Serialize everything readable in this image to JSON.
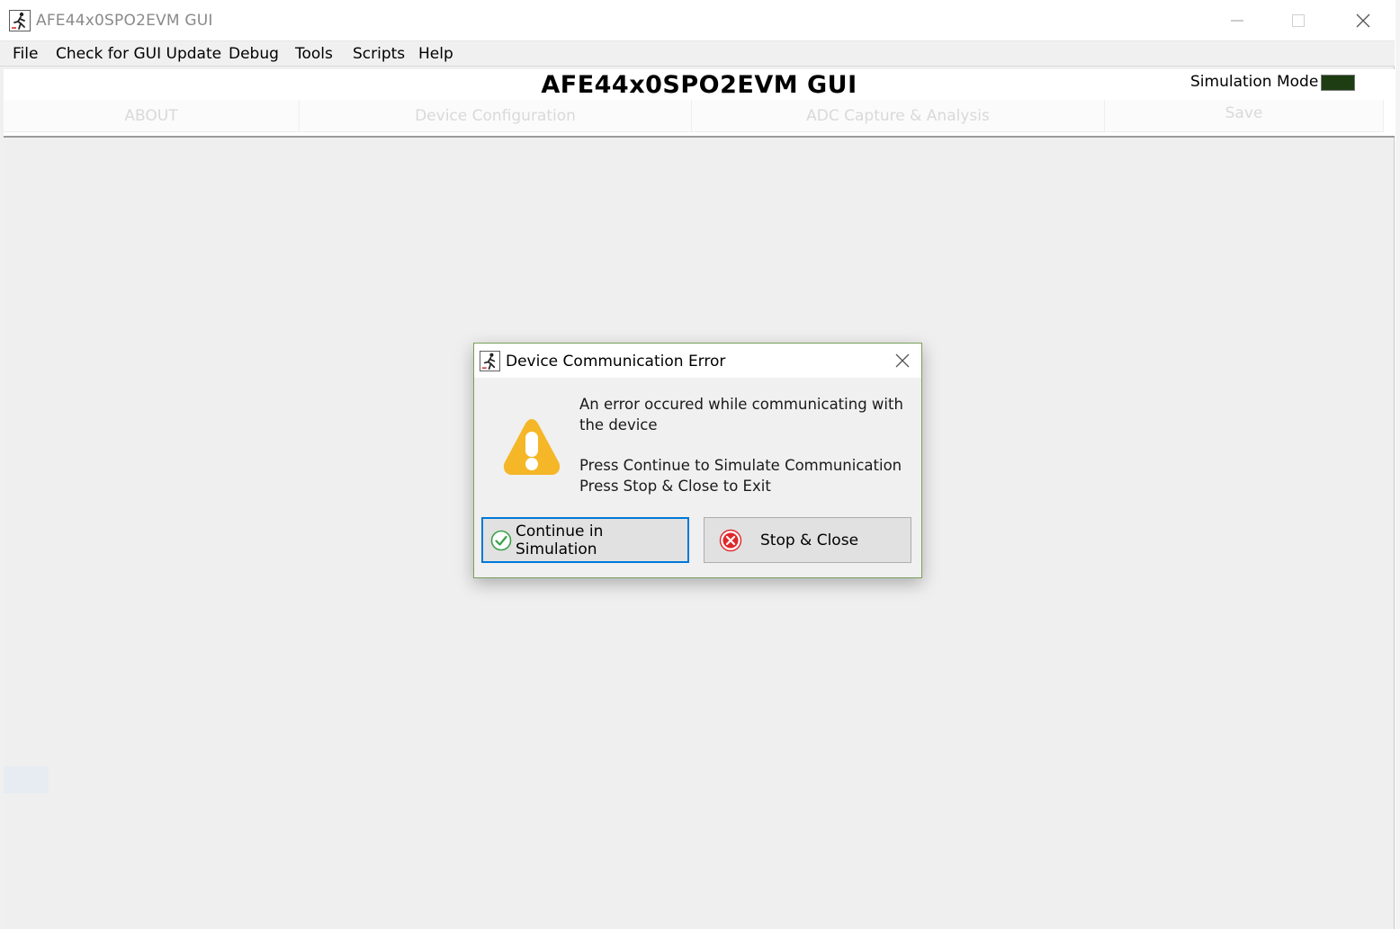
{
  "window": {
    "title": "AFE44x0SPO2EVM GUI",
    "icons": {
      "app": "running-figure-icon",
      "minimize": "minimize-icon",
      "maximize": "maximize-icon",
      "close": "close-icon"
    }
  },
  "menu": {
    "items": [
      {
        "label": "File"
      },
      {
        "label": "Check for GUI Update"
      },
      {
        "label": "Debug"
      },
      {
        "label": "Tools"
      },
      {
        "label": "Scripts"
      },
      {
        "label": "Help"
      }
    ]
  },
  "header": {
    "heading": "AFE44x0SPO2EVM GUI",
    "simulation_label": "Simulation Mode",
    "simulation_indicator_color": "#1e3d12"
  },
  "tabs": [
    {
      "label": "ABOUT"
    },
    {
      "label": "Device Configuration"
    },
    {
      "label": "ADC Capture & Analysis"
    },
    {
      "label": "Save"
    }
  ],
  "dialog": {
    "title": "Device Communication Error",
    "icon": "warning-icon",
    "message_line1": "An error occured while communicating with",
    "message_line2": "the device",
    "instruction_line1": "Press Continue to Simulate Communication",
    "instruction_line2": "Press Stop & Close to Exit",
    "continue_label": "Continue in Simulation",
    "stop_label": "Stop & Close",
    "colors": {
      "warning": "#f5b728",
      "accent_border": "#0078d7",
      "check": "#3aa04a",
      "stop": "#e0282b"
    }
  }
}
